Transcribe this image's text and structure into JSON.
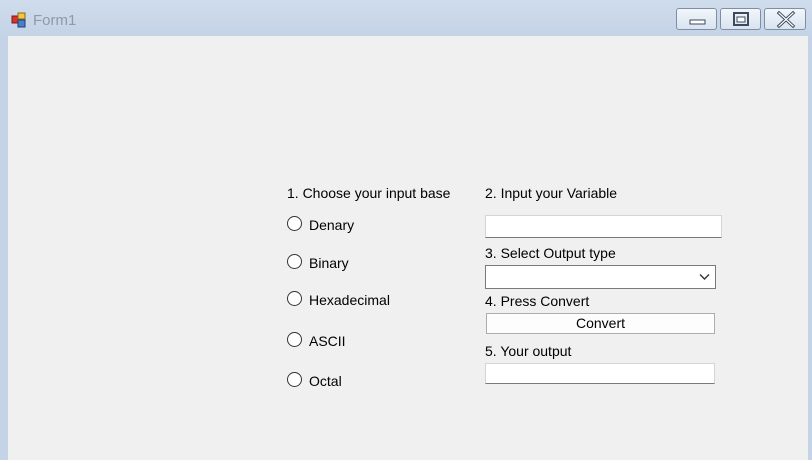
{
  "window": {
    "title": "Form1",
    "controls": {
      "minimize": "minimize-icon",
      "maximize": "maximize-icon",
      "close": "close-icon"
    }
  },
  "form": {
    "step1_label": "1. Choose your input base",
    "input_bases": [
      "Denary",
      "Binary",
      "Hexadecimal",
      "ASCII",
      "Octal"
    ],
    "selected_input_base": null,
    "step2_label": "2. Input your Variable",
    "variable_value": "",
    "step3_label": "3. Select Output type",
    "output_type_selected": "",
    "step4_label": "4. Press Convert",
    "convert_button": "Convert",
    "step5_label": "5. Your output",
    "output_value": ""
  }
}
